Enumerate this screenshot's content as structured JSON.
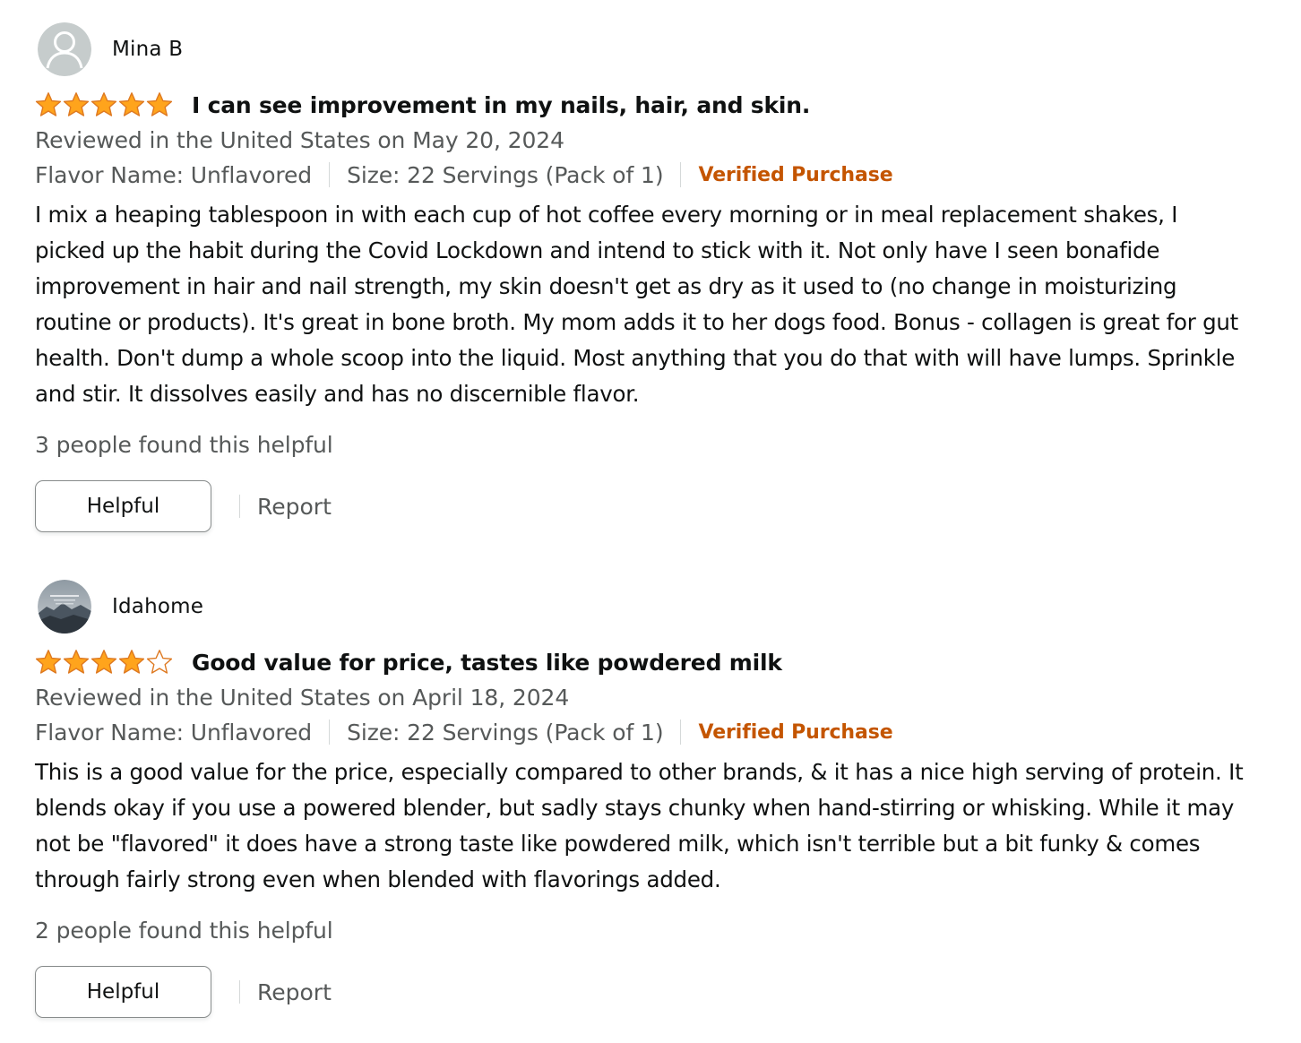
{
  "colors": {
    "star_fill": "#ffa41c",
    "star_stroke": "#de7921",
    "verified": "#c45500",
    "muted_text": "#565959"
  },
  "reviews": [
    {
      "profile_name": "Mina B",
      "avatar_icon": "default-user-avatar-icon",
      "rating": 5,
      "title": "I can see improvement in my nails, hair, and skin.",
      "date_line": "Reviewed in the United States on May 20, 2024",
      "flavor": "Flavor Name: Unflavored",
      "size": "Size: 22 Servings (Pack of 1)",
      "verified": "Verified Purchase",
      "body": "I mix a heaping tablespoon in with each cup of hot coffee every morning or in meal replacement shakes, I picked up the habit during the Covid Lockdown and intend to stick with it. Not only have I seen bonafide improvement in hair and nail strength, my skin doesn't get as dry as it used to (no change in moisturizing routine or products). It's great in bone broth. My mom adds it to her dogs food. Bonus - collagen is great for gut health. Don't dump a whole scoop into the liquid. Most anything that you do that with will have lumps. Sprinkle and stir. It dissolves easily and has no discernible flavor.",
      "helpful_count": "3 people found this helpful",
      "helpful_button": "Helpful",
      "report_link": "Report"
    },
    {
      "profile_name": "Idahome",
      "avatar_icon": "landscape-photo-avatar",
      "rating": 4,
      "title": "Good value for price, tastes like powdered milk",
      "date_line": "Reviewed in the United States on April 18, 2024",
      "flavor": "Flavor Name: Unflavored",
      "size": "Size: 22 Servings (Pack of 1)",
      "verified": "Verified Purchase",
      "body": "This is a good value for the price, especially compared to other brands, & it has a nice high serving of protein. It blends okay if you use a powered blender, but sadly stays chunky when hand-stirring or whisking. While it may not be \"flavored\" it does have a strong taste like powdered milk, which isn't terrible but a bit funky & comes through fairly strong even when blended with flavorings added.",
      "helpful_count": "2 people found this helpful",
      "helpful_button": "Helpful",
      "report_link": "Report"
    }
  ]
}
